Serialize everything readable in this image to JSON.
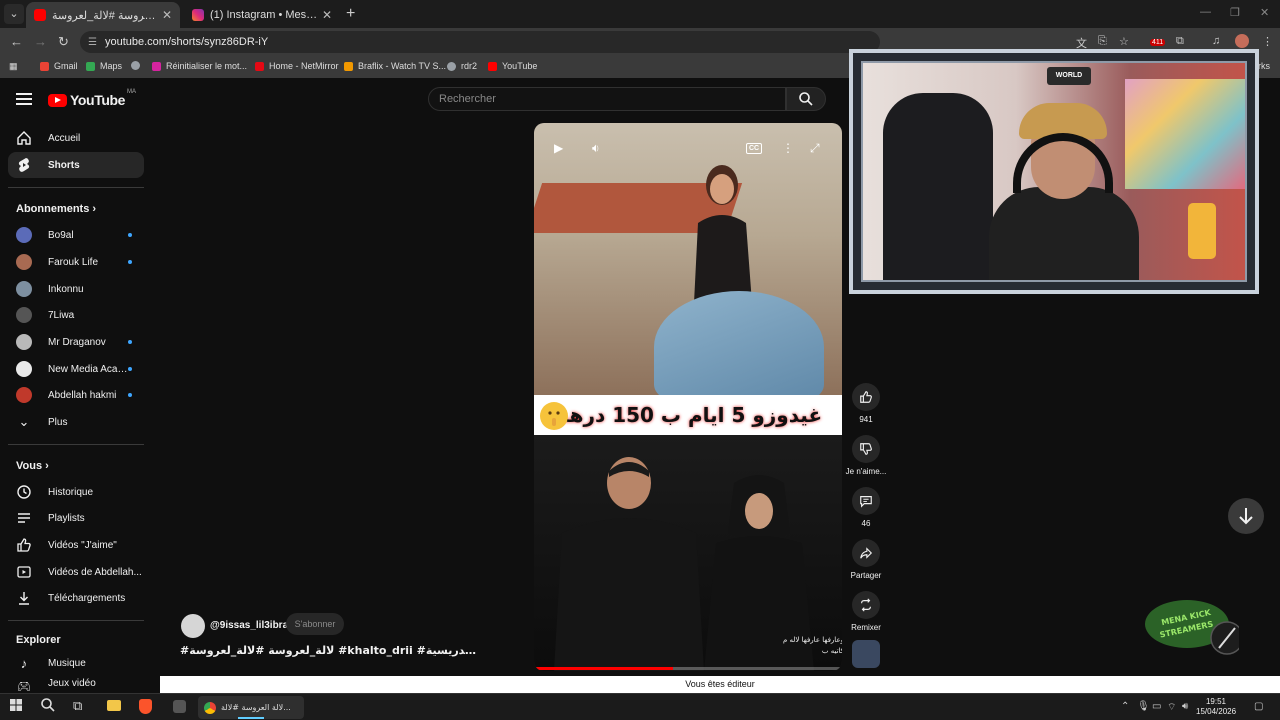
{
  "browser": {
    "tabs": [
      {
        "title": "لالة العروسة #لالة_لعروسة#",
        "active": true,
        "favicon": "youtube-icon"
      },
      {
        "title": "(1) Instagram • Messages",
        "active": false,
        "favicon": "instagram-icon"
      }
    ],
    "url": "youtube.com/shorts/synz86DR-iY",
    "extension_badge": "411",
    "bookmarks": [
      {
        "label": "Gmail",
        "color": "#ea4335"
      },
      {
        "label": "Maps",
        "color": "#34a853"
      },
      {
        "label": "",
        "color": "#9aa0a6"
      },
      {
        "label": "Réinitialiser le mot...",
        "color": "#d6249f"
      },
      {
        "label": "Home - NetMirror",
        "color": "#e50914"
      },
      {
        "label": "Braflix - Watch TV S...",
        "color": "#f29900"
      },
      {
        "label": "rdr2",
        "color": "#9aa0a6"
      },
      {
        "label": "YouTube",
        "color": "#ff0000"
      }
    ],
    "bookmarks_tail": "rks"
  },
  "youtube": {
    "logo_text": "YouTube",
    "country_code": "MA",
    "search_placeholder": "Rechercher",
    "nav": [
      {
        "label": "Accueil",
        "icon": "home-icon",
        "selected": false
      },
      {
        "label": "Shorts",
        "icon": "shorts-icon",
        "selected": true
      }
    ],
    "subscriptions_heading": "Abonnements",
    "subscriptions": [
      {
        "label": "Bo9al",
        "dot": true,
        "color": "#5b6bb8"
      },
      {
        "label": "Farouk Life",
        "dot": true,
        "color": "#a86a52"
      },
      {
        "label": "Inkonnu",
        "dot": false,
        "color": "#7d8fa0"
      },
      {
        "label": "7Liwa",
        "dot": false,
        "color": "#555555"
      },
      {
        "label": "Mr Draganov",
        "dot": true,
        "color": "#b9b9b9"
      },
      {
        "label": "New Media Acad...",
        "dot": true,
        "color": "#e9e9e9"
      },
      {
        "label": "Abdellah hakmi",
        "dot": true,
        "color": "#c0392b"
      }
    ],
    "more_label": "Plus",
    "you_heading": "Vous",
    "you_items": [
      {
        "label": "Historique",
        "icon": "history-icon"
      },
      {
        "label": "Playlists",
        "icon": "playlists-icon"
      },
      {
        "label": "Vidéos \"J'aime\"",
        "icon": "thumbs-up-icon"
      },
      {
        "label": "Vidéos de Abdellah...",
        "icon": "your-videos-icon"
      },
      {
        "label": "Téléchargements",
        "icon": "download-icon"
      }
    ],
    "explore_heading": "Explorer",
    "explore_items": [
      {
        "label": "Musique",
        "icon": "music-icon"
      },
      {
        "label": "Jeux vidéo",
        "icon": "gaming-icon"
      }
    ]
  },
  "short": {
    "caption": "غيدوزو 5 ايام ب 150 درهم",
    "subtitle_line1": "وعارفها عارفها لاله م",
    "subtitle_line2": "كاتيه ب",
    "progress_fraction": 0.45,
    "channel": "@9issas_lil3ibra",
    "subscribe_label": "S'abonner",
    "title": "#لالة_لعروسة #لالة_لعروسة #khalto_drii #خالتو_الدريسية ..."
  },
  "actions": {
    "like_count": "941",
    "dislike_label": "Je n'aime...",
    "comments_count": "46",
    "share_label": "Partager",
    "remix_label": "Remixer"
  },
  "overlay": {
    "cam_logo": "WORLD",
    "kick_badge": "MENA KICK STREAMERS"
  },
  "statusbar_text": "Vous êtes éditeur",
  "taskbar": {
    "app_label": "لالة العروسة #لالة...",
    "time": "19:51",
    "date": "15/04/2026"
  }
}
